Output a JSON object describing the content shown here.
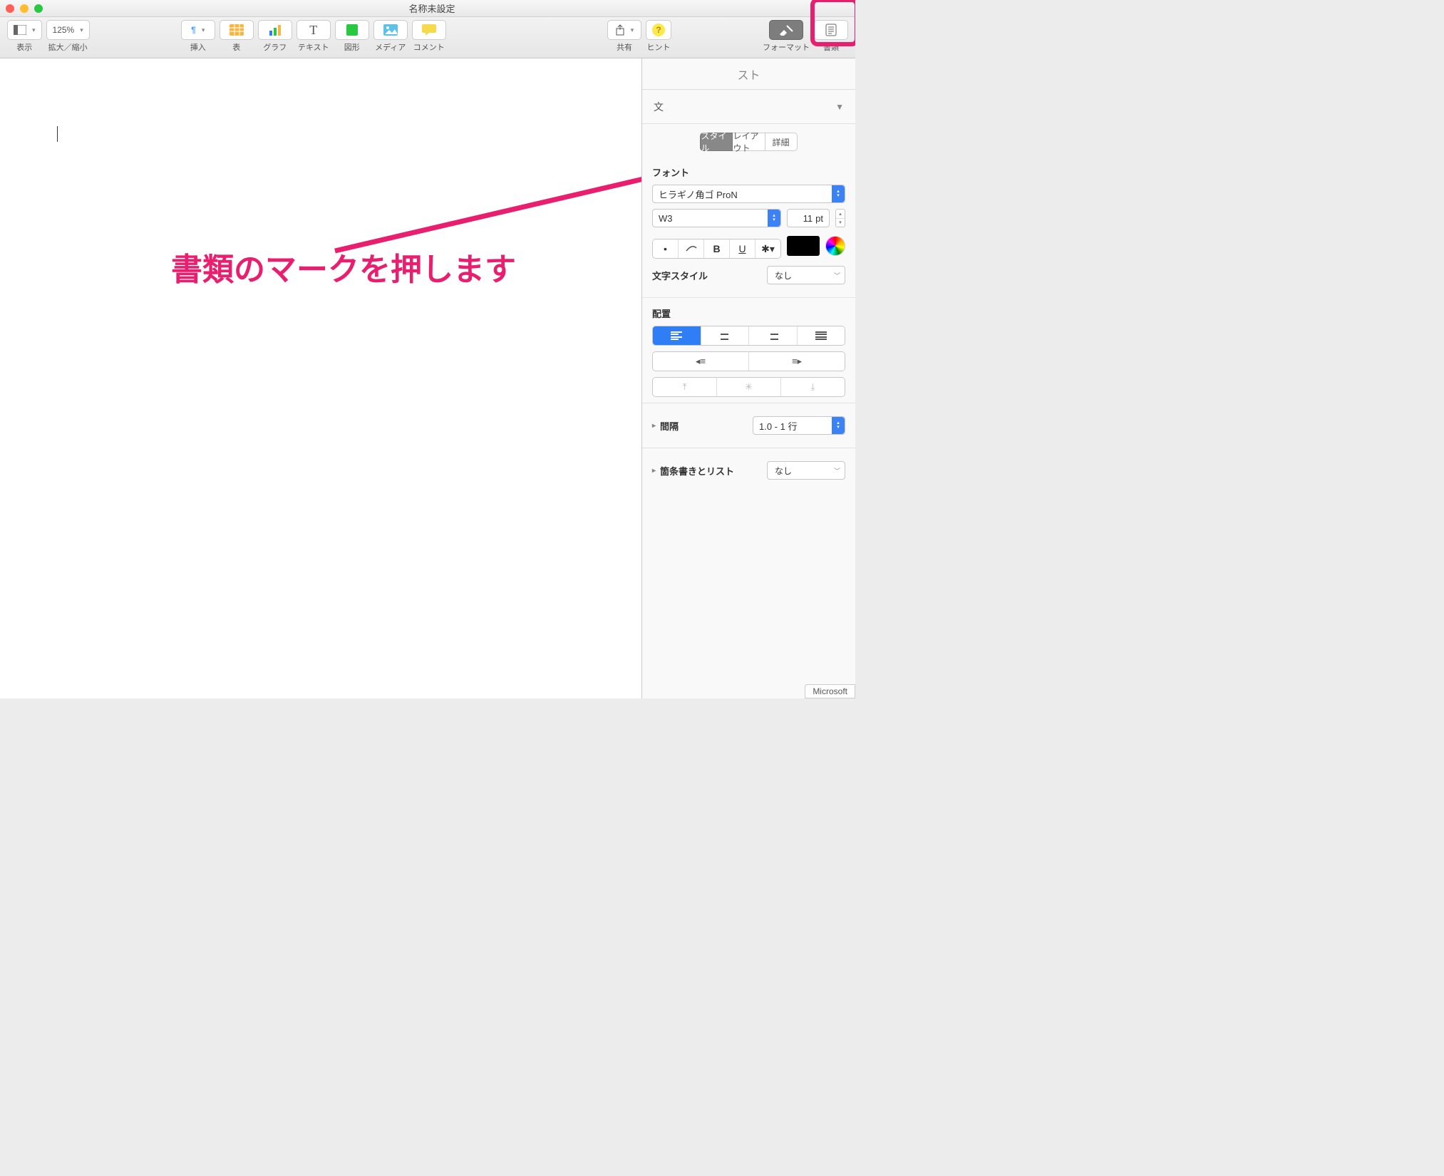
{
  "window": {
    "title": "名称未設定"
  },
  "toolbar": {
    "view_label": "表示",
    "zoom_value": "125%",
    "zoom_label": "拡大／縮小",
    "insert_label": "挿入",
    "table_label": "表",
    "chart_label": "グラフ",
    "text_label": "テキスト",
    "shape_label": "図形",
    "media_label": "メディア",
    "comment_label": "コメント",
    "share_label": "共有",
    "hint_label": "ヒント",
    "format_label": "フォーマット",
    "document_label": "書類"
  },
  "annotation": {
    "text": "書類のマークを押します"
  },
  "panel": {
    "tab_partial": "スト",
    "paragraph_style_partial": "文",
    "tabs": {
      "style": "スタイル",
      "layout": "レイアウト",
      "detail": "詳細"
    },
    "font": {
      "label": "フォント",
      "family": "ヒラギノ角ゴ ProN",
      "weight": "W3",
      "size_value": "11",
      "size_unit": "pt",
      "bold": "B",
      "underline": "U",
      "char_style_label": "文字スタイル",
      "char_style_value": "なし"
    },
    "alignment": {
      "label": "配置"
    },
    "spacing": {
      "label": "間隔",
      "value": "1.0 - 1 行"
    },
    "bullets": {
      "label": "箇条書きとリスト",
      "value": "なし"
    }
  },
  "footer_tag": "Microsoft"
}
